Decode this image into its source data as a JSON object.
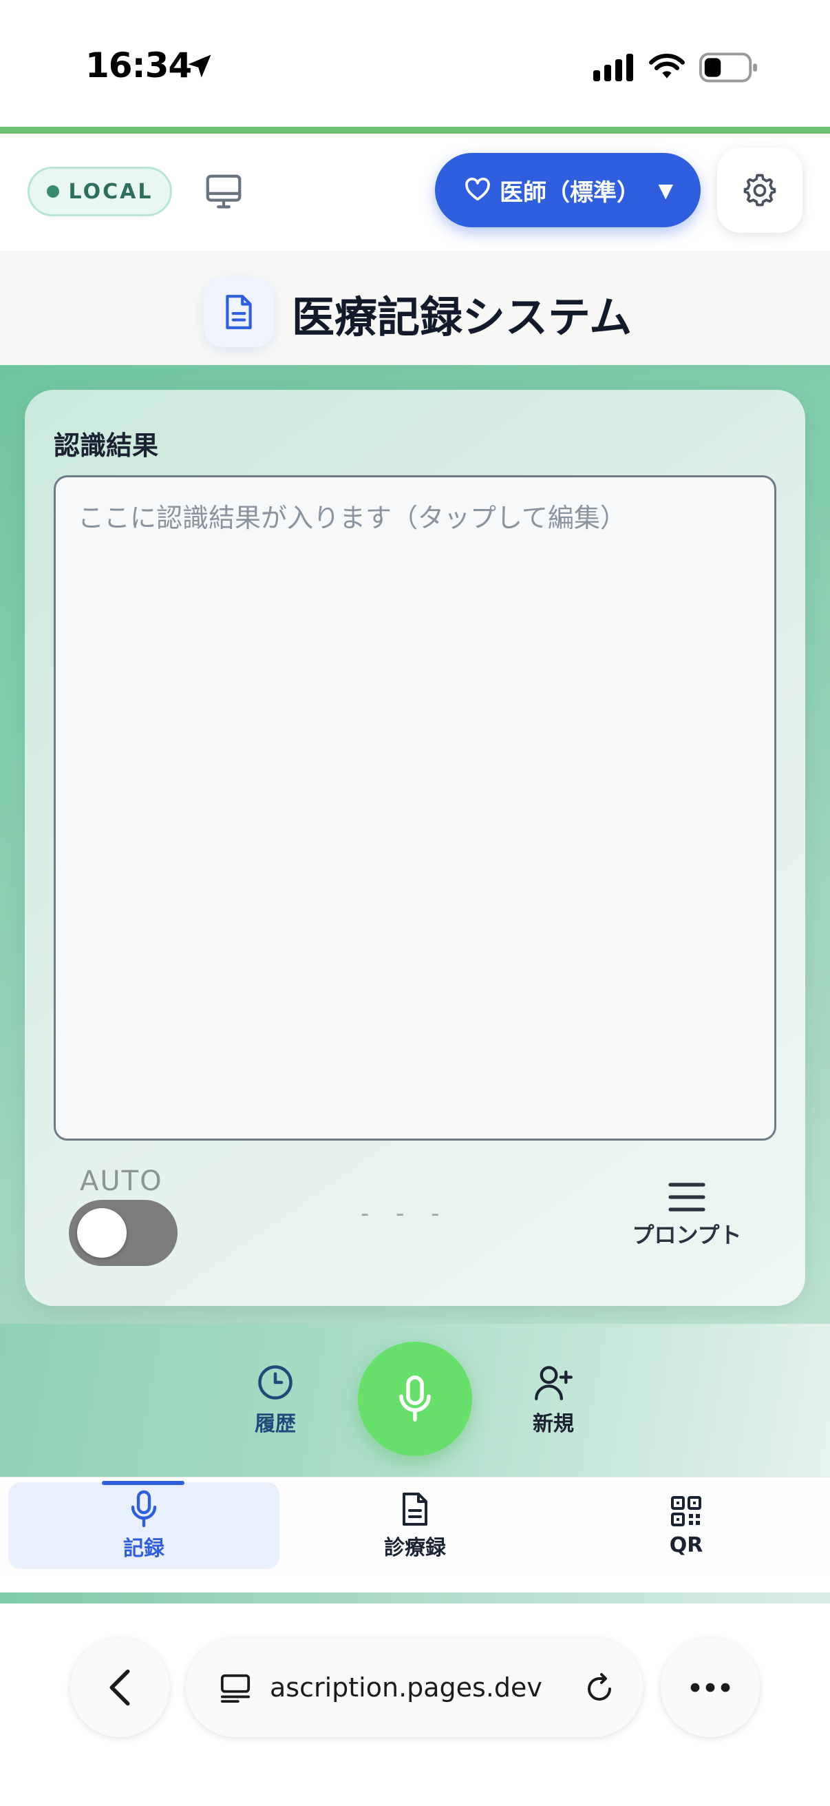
{
  "status_bar": {
    "time": "16:34"
  },
  "header": {
    "local_badge": "LOCAL",
    "role_button": "医師（標準）",
    "role_arrow": "▼"
  },
  "title": {
    "text": "医療記録システム"
  },
  "card": {
    "result_label": "認識結果",
    "textarea_placeholder": "ここに認識結果が入ります（タップして編集）",
    "textarea_value": "",
    "auto_label": "AUTO",
    "auto_toggle_on": false,
    "level_indicator": "- - -",
    "prompt_label": "プロンプト"
  },
  "actions": {
    "history_label": "履歴",
    "new_label": "新規"
  },
  "bottom_nav": {
    "items": [
      {
        "label": "記録",
        "active": true
      },
      {
        "label": "診療録",
        "active": false
      },
      {
        "label": "QR",
        "active": false
      }
    ]
  },
  "browser": {
    "url": "ascription.pages.dev"
  },
  "colors": {
    "accent_blue": "#2f5fdf",
    "mic_green": "#66e06a",
    "main_green": "#6fc59e",
    "local_badge_text": "#2e6e5e"
  }
}
